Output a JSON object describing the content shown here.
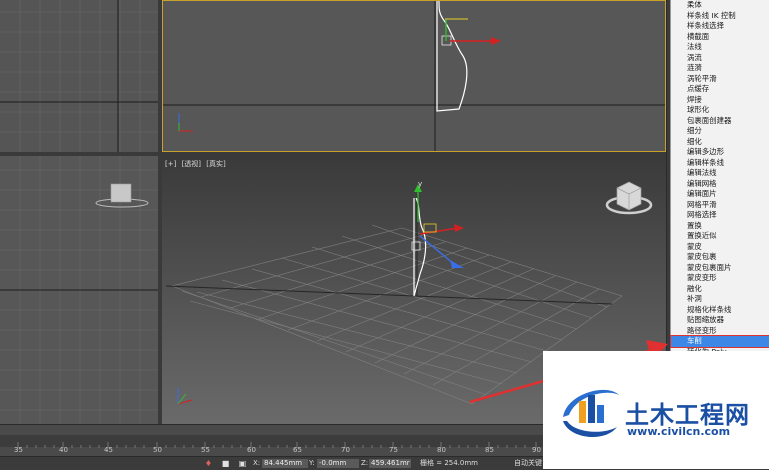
{
  "viewport_perspective": {
    "labels": [
      "[+]",
      "[透视]",
      "[真实]"
    ],
    "axis_y_label": "y"
  },
  "modifier_menu": {
    "items": [
      "柔体",
      "样条线 IK 控制",
      "样条线选择",
      "横截面",
      "法线",
      "涡流",
      "涟漪",
      "涡轮平滑",
      "点缓存",
      "焊接",
      "球形化",
      "包裹面创建器",
      "细分",
      "细化",
      "编辑多边形",
      "编辑样条线",
      "编辑法线",
      "编辑网格",
      "编辑面片",
      "网格平滑",
      "网格选择",
      "置换",
      "置换近似",
      "蒙皮",
      "蒙皮包裹",
      "蒙皮包裹面片",
      "蒙皮变形",
      "融化",
      "补洞",
      "规格化样条线",
      "贴图缩放器",
      "路径变形",
      "车削",
      "转化为 Poly"
    ],
    "selected": "车削"
  },
  "timeline": {
    "ticks": [
      "35",
      "40",
      "45",
      "50",
      "55",
      "60",
      "65",
      "70",
      "75",
      "80",
      "85",
      "90"
    ]
  },
  "status_bar": {
    "x_label": "X:",
    "x_value": "84.445mm",
    "y_label": "Y:",
    "y_value": "-0.0mm",
    "z_label": "Z:",
    "z_value": "459.461mr",
    "grid_label": "栅格 = 254.0mm",
    "autokey_label": "自动关键"
  },
  "watermark": {
    "title": "土木工程网",
    "url": "www.civilcn.com"
  },
  "colors": {
    "accent_selection": "#3d87e6",
    "active_viewport_border": "#c8a22a",
    "annotation_arrow": "#e03030",
    "logo_blue": "#1b4fa3"
  }
}
